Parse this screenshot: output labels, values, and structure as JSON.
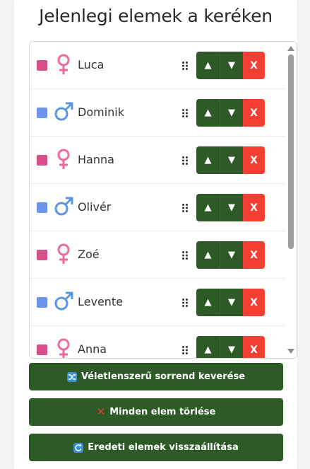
{
  "title": "Jelenlegi elemek a keréken",
  "colors": {
    "female": "#d54f8b",
    "male": "#6d94e8",
    "female_symbol": "#ec6a9e",
    "male_symbol": "#5b96e3",
    "green": "#2d5a27",
    "red": "#f33e34"
  },
  "buttons": {
    "up": "▲",
    "down": "▼",
    "delete": "X"
  },
  "items": [
    {
      "name": "Luca",
      "gender": "female"
    },
    {
      "name": "Dominik",
      "gender": "male"
    },
    {
      "name": "Hanna",
      "gender": "female"
    },
    {
      "name": "Olivér",
      "gender": "male"
    },
    {
      "name": "Zoé",
      "gender": "female"
    },
    {
      "name": "Levente",
      "gender": "male"
    },
    {
      "name": "Anna",
      "gender": "female"
    }
  ],
  "actions": {
    "shuffle": {
      "label": "Véletlenszerű sorrend keverése",
      "icon": "shuffle-icon"
    },
    "clear": {
      "label": "Minden elem törlése",
      "icon": "cross-mark-icon"
    },
    "restore": {
      "label": "Eredeti elemek visszaállítása",
      "icon": "restore-icon"
    }
  }
}
